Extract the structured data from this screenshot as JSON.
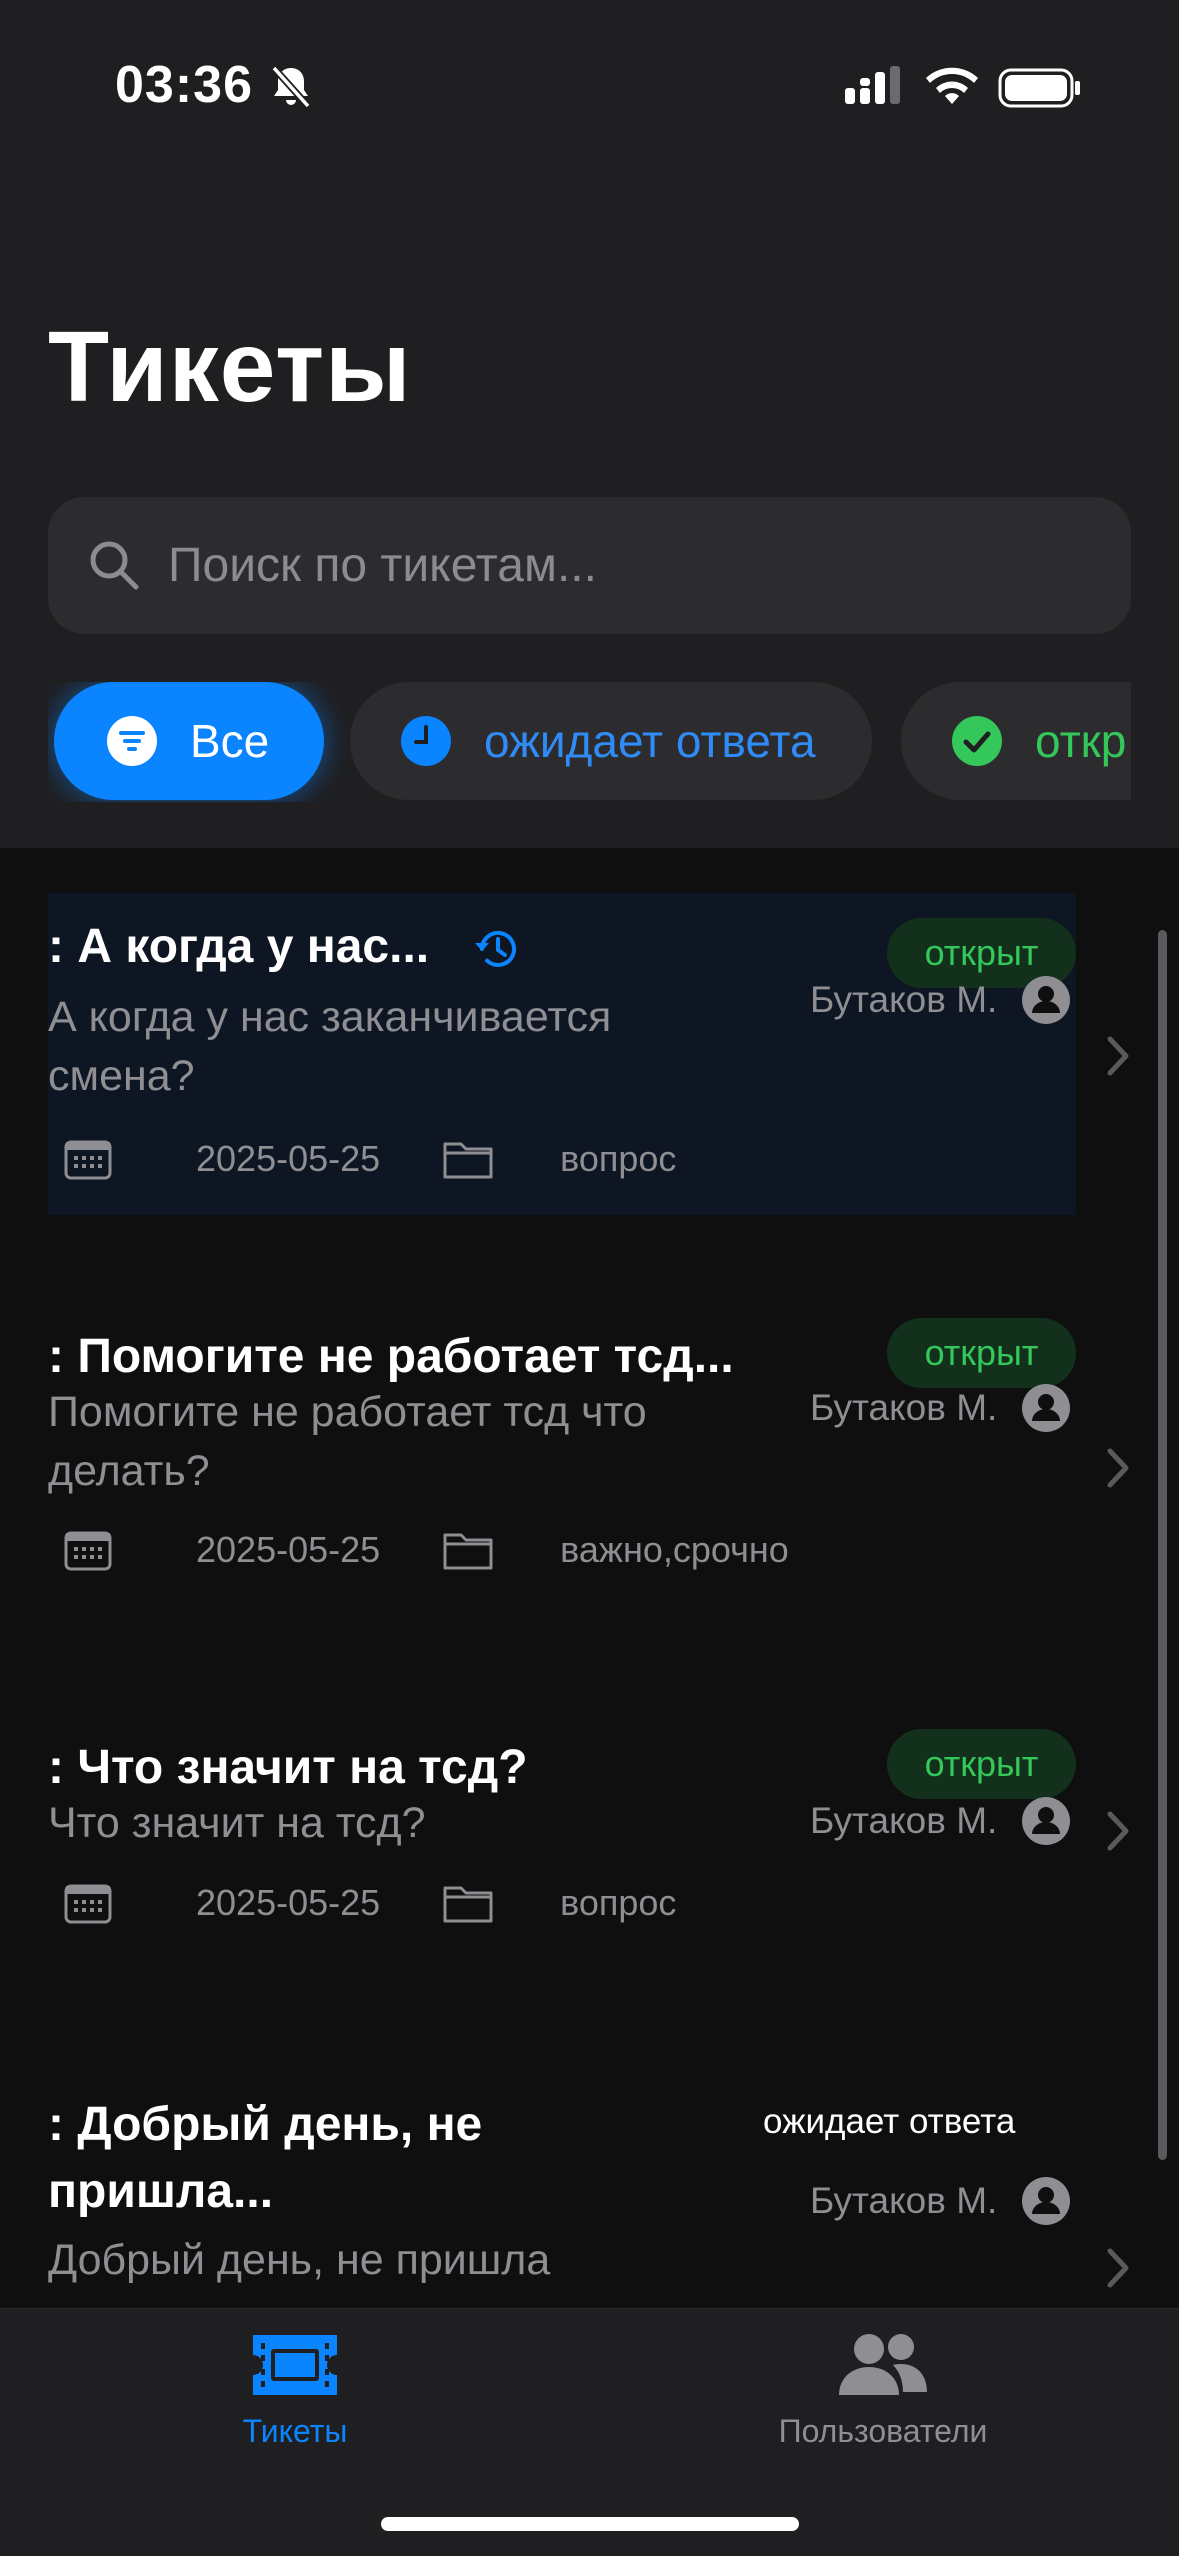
{
  "status_bar": {
    "time": "03:36",
    "icons": [
      "bell-slash-icon",
      "cellular-signal-icon",
      "wifi-icon",
      "battery-icon"
    ]
  },
  "page": {
    "title": "Тикеты"
  },
  "search": {
    "placeholder": "Поиск по тикетам..."
  },
  "filters": [
    {
      "label": "Все",
      "icon": "filter-icon",
      "selected": true,
      "color": "#0a84ff"
    },
    {
      "label": "ожидает ответа",
      "icon": "clock-icon",
      "selected": false,
      "color": "#2f8bf5"
    },
    {
      "label": "откр",
      "icon": "checkmark-circle-icon",
      "selected": false,
      "color": "#34c759"
    }
  ],
  "tickets": [
    {
      "title": ": А когда у нас...",
      "description_lines": [
        "А когда у нас заканчивается",
        "смена?"
      ],
      "status": "открыт",
      "author": "Бутаков М.",
      "date": "2025-05-25",
      "category": "вопрос",
      "has_history_icon": true
    },
    {
      "title": ": Помогите не работает тсд...",
      "description_lines": [
        "Помогите не работает тсд что",
        "делать?"
      ],
      "status": "открыт",
      "author": "Бутаков М.",
      "date": "2025-05-25",
      "category": "важно,срочно"
    },
    {
      "title": ": Что значит на тсд?",
      "description_lines": [
        "Что значит на тсд?"
      ],
      "status": "открыт",
      "author": "Бутаков М.",
      "date": "2025-05-25",
      "category": "вопрос"
    },
    {
      "title_lines": [
        ": Добрый день, не",
        "пришла..."
      ],
      "description_lines": [
        "Добрый день, не пришла"
      ],
      "status": "ожидает ответа",
      "author": "Бутаков М."
    }
  ],
  "tabbar": {
    "tickets_label": "Тикеты",
    "users_label": "Пользователи",
    "active_color": "#0a84ff",
    "inactive_color": "#8e8e93"
  },
  "colors": {
    "background": "#0f0f10",
    "header": "#1f1f21",
    "accent": "#0a84ff",
    "status_open": "#34c759"
  }
}
